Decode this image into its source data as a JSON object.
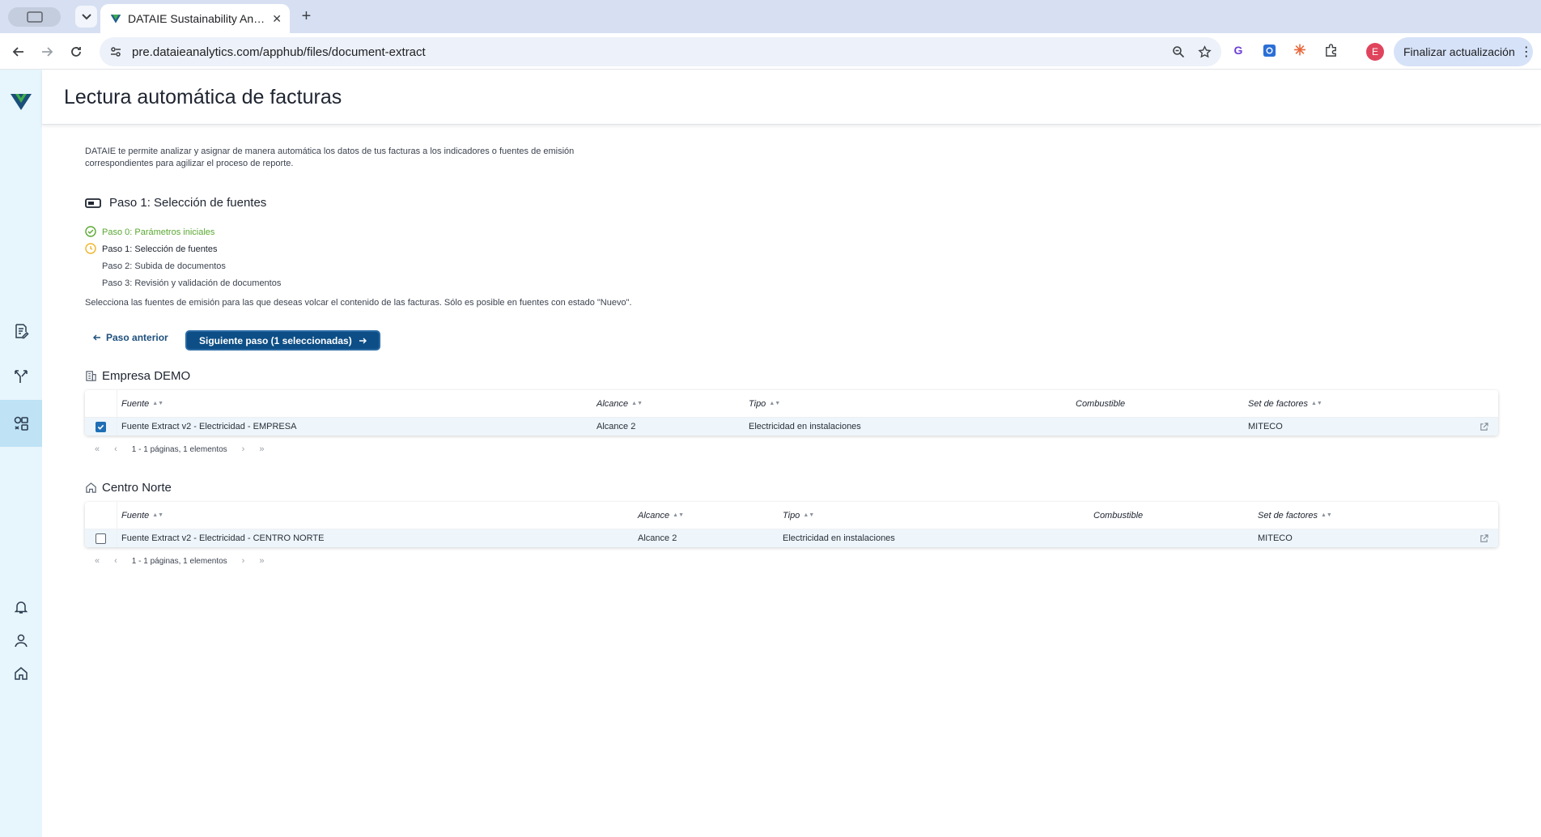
{
  "browser": {
    "tab_title": "DATAIE Sustainability Analytics",
    "url": "pre.dataieanalytics.com/apphub/files/document-extract",
    "avatar_letter": "E",
    "update_label": "Finalizar actualización"
  },
  "page": {
    "title": "Lectura automática de facturas",
    "intro_line1": "DATAIE te permite analizar y asignar de manera automática los datos de tus facturas a los indicadores o fuentes de emisión",
    "intro_line2": "correspondientes para agilizar el proceso de reporte.",
    "step_title": "Paso 1: Selección de fuentes",
    "steps": [
      {
        "label": "Paso 0: Parámetros iniciales",
        "status": "done"
      },
      {
        "label": "Paso 1: Selección de fuentes",
        "status": "current"
      },
      {
        "label": "Paso 2: Subida de documentos",
        "status": "pending"
      },
      {
        "label": "Paso 3: Revisión y validación de documentos",
        "status": "pending"
      }
    ],
    "select_note": "Selecciona las fuentes de emisión para las que deseas volcar el contenido de las facturas. Sólo es posible en fuentes con estado \"Nuevo\".",
    "prev_label": "Paso anterior",
    "next_label": "Siguiente paso (1 seleccionadas)"
  },
  "groups": [
    {
      "name": "Empresa DEMO",
      "headers": [
        "Fuente",
        "Alcance",
        "Tipo",
        "Combustible",
        "Set de factores"
      ],
      "rows": [
        {
          "checked": true,
          "fuente": "Fuente Extract v2 - Electricidad - EMPRESA",
          "alcance": "Alcance 2",
          "tipo": "Electricidad en instalaciones",
          "combustible": "",
          "set": "MITECO"
        }
      ],
      "pager": {
        "page": "1",
        "summary": "1 páginas, 1 elementos"
      }
    },
    {
      "name": "Centro Norte",
      "headers": [
        "Fuente",
        "Alcance",
        "Tipo",
        "Combustible",
        "Set de factores"
      ],
      "rows": [
        {
          "checked": false,
          "fuente": "Fuente Extract v2 - Electricidad - CENTRO NORTE",
          "alcance": "Alcance 2",
          "tipo": "Electricidad en instalaciones",
          "combustible": "",
          "set": "MITECO"
        }
      ],
      "pager": {
        "page": "1",
        "summary": "1 páginas, 1 elementos"
      }
    }
  ],
  "colors": {
    "primary": "#0d4e86",
    "done": "#5aa832",
    "current": "#f0b429",
    "sidebar_active": "#bfe2f5"
  }
}
